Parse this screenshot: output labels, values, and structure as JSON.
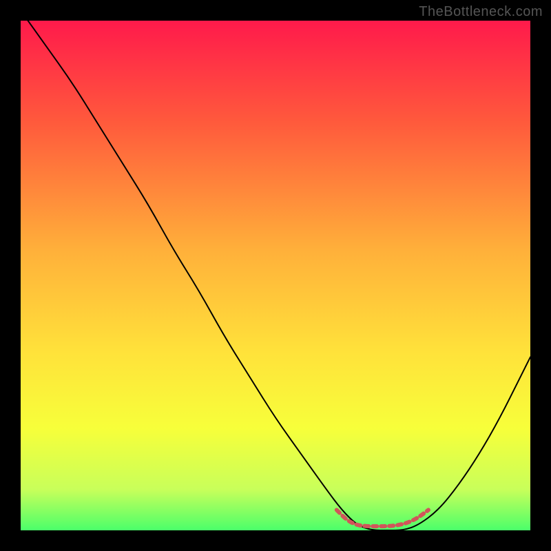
{
  "watermark": "TheBottleneck.com",
  "chart_data": {
    "type": "line",
    "title": "",
    "xlabel": "",
    "ylabel": "",
    "xlim": [
      0,
      100
    ],
    "ylim": [
      0,
      100
    ],
    "gradient_stops": [
      {
        "offset": 0.0,
        "color": "#ff1a4b"
      },
      {
        "offset": 0.2,
        "color": "#ff5a3c"
      },
      {
        "offset": 0.45,
        "color": "#ffb03a"
      },
      {
        "offset": 0.65,
        "color": "#ffe23a"
      },
      {
        "offset": 0.8,
        "color": "#f7ff3a"
      },
      {
        "offset": 0.92,
        "color": "#c8ff5a"
      },
      {
        "offset": 1.0,
        "color": "#4bff6a"
      }
    ],
    "series": [
      {
        "name": "bottleneck-curve",
        "stroke": "#000000",
        "stroke_width": 2,
        "x": [
          0,
          5,
          10,
          15,
          20,
          25,
          30,
          35,
          40,
          45,
          50,
          55,
          60,
          63,
          66,
          69,
          72,
          75,
          78,
          82,
          86,
          90,
          94,
          98,
          100
        ],
        "values": [
          102,
          95,
          88,
          80,
          72,
          64,
          55,
          47,
          38,
          30,
          22,
          15,
          8,
          4,
          1,
          0,
          0,
          0,
          1,
          4,
          9,
          15,
          22,
          30,
          34
        ]
      },
      {
        "name": "optimal-marker",
        "stroke": "#d1555a",
        "stroke_width": 6,
        "dash": "6 6",
        "x": [
          62,
          64,
          66,
          68,
          70,
          72,
          74,
          76,
          78,
          80
        ],
        "values": [
          4,
          2,
          1,
          0.8,
          0.8,
          0.8,
          1,
          1.5,
          2.5,
          4
        ]
      }
    ]
  }
}
